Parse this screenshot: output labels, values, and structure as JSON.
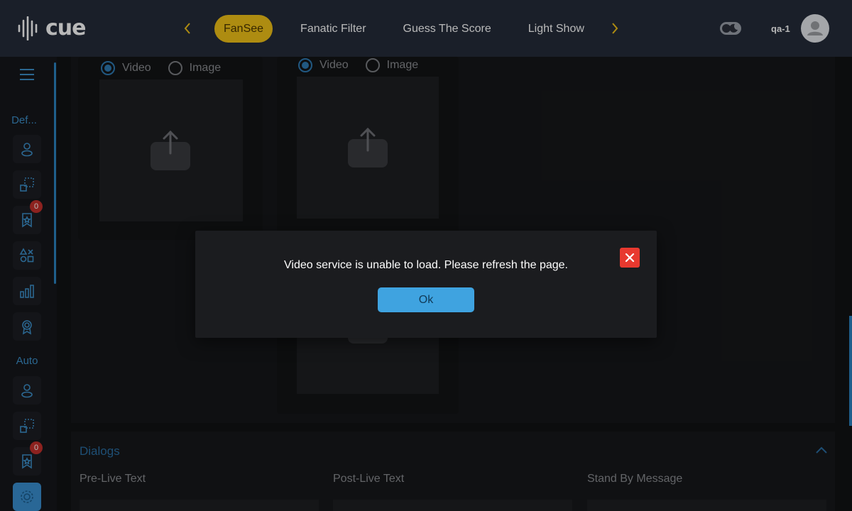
{
  "app": {
    "logo_text": "cue"
  },
  "header": {
    "tabs": [
      {
        "label": "FanSee",
        "active": true
      },
      {
        "label": "Fanatic Filter"
      },
      {
        "label": "Guess The Score"
      },
      {
        "label": "Light Show"
      }
    ],
    "username": "qa-1",
    "accent_color": "#f2c318"
  },
  "sidebar": {
    "sections": [
      {
        "label": "Def...",
        "items": [
          "person-icon",
          "crop-icon",
          "bookmark-star-icon",
          "shapes-icon",
          "bar-chart-icon",
          "award-icon"
        ],
        "badge": "0"
      },
      {
        "label": "Auto",
        "items": [
          "person-icon",
          "crop-icon",
          "bookmark-star-icon",
          "settings-icon"
        ],
        "badge": "0"
      }
    ]
  },
  "media": {
    "option_video": "Video",
    "option_image": "Image"
  },
  "dialogs": {
    "title": "Dialogs",
    "columns": [
      "Pre-Live Text",
      "Post-Live Text",
      "Stand By Message"
    ]
  },
  "modal": {
    "message": "Video service is unable to load. Please refresh the page.",
    "ok_label": "Ok",
    "close_color": "#e8392f",
    "button_color": "#3fa3e0"
  }
}
